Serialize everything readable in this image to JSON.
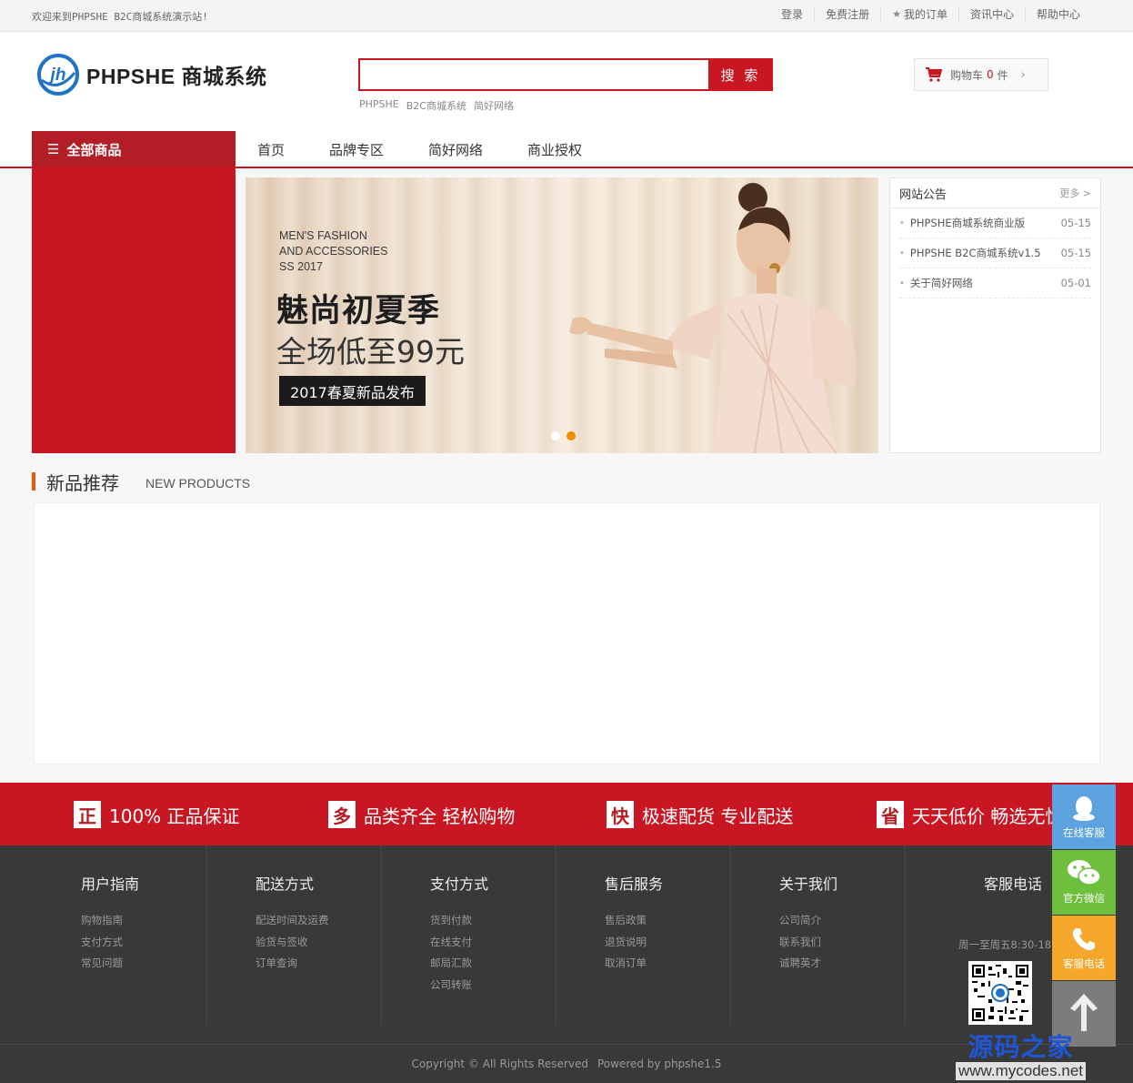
{
  "topbar": {
    "welcome": "欢迎来到PHPSHE B2C商城系统演示站!",
    "links": [
      "登录",
      "免费注册",
      "我的订单",
      "资讯中心",
      "帮助中心"
    ]
  },
  "header": {
    "logo_text": "PHPSHE 商城系统",
    "search_placeholder": "",
    "search_button": "搜 索",
    "hot_words": [
      "PHPSHE",
      "B2C商城系统",
      "简好网络"
    ],
    "cart_label": "购物车",
    "cart_count": "0",
    "cart_unit": "件",
    "cart_arrow": "›"
  },
  "nav": {
    "all_categories": "全部商品",
    "links": [
      "首页",
      "品牌专区",
      "简好网络",
      "商业授权"
    ]
  },
  "banner": {
    "english": "MEN'S FASHION\nAND ACCESSORIES\nSS 2017",
    "headline": "魅尚初夏季",
    "subheadline": "全场低至99元",
    "tag": "2017春夏新品发布",
    "slides": 2,
    "active_slide": 2
  },
  "notice": {
    "title": "网站公告",
    "more": "更多 >",
    "items": [
      {
        "title": "PHPSHE商城系统商业版",
        "date": "05-15"
      },
      {
        "title": "PHPSHE B2C商城系统v1.5",
        "date": "05-15"
      },
      {
        "title": "关于简好网络",
        "date": "05-01"
      }
    ]
  },
  "section": {
    "title": "新品推荐",
    "subtitle": "NEW PRODUCTS"
  },
  "promises": [
    {
      "badge": "正",
      "text": "100% 正品保证"
    },
    {
      "badge": "多",
      "text": "品类齐全 轻松购物"
    },
    {
      "badge": "快",
      "text": "极速配货 专业配送"
    },
    {
      "badge": "省",
      "text": "天天低价 畅选无忧"
    }
  ],
  "footer": {
    "columns": [
      {
        "title": "用户指南",
        "links": [
          "购物指南",
          "支付方式",
          "常见问题"
        ]
      },
      {
        "title": "配送方式",
        "links": [
          "配送时间及运费",
          "验货与签收",
          "订单查询"
        ]
      },
      {
        "title": "支付方式",
        "links": [
          "货到付款",
          "在线支付",
          "邮局汇款",
          "公司转账"
        ]
      },
      {
        "title": "售后服务",
        "links": [
          "售后政策",
          "退货说明",
          "取消订单"
        ]
      },
      {
        "title": "关于我们",
        "links": [
          "公司简介",
          "联系我们",
          "诚聘英才"
        ]
      }
    ],
    "service_title": "客服电话",
    "service_hours": "周一至周五8:30-18",
    "copyright": "Copyright © All Rights Reserved",
    "powered": "Powered by phpshe1.5"
  },
  "side": {
    "online": "在线客服",
    "wechat": "官方微信",
    "phone": "客服电话"
  },
  "watermark": {
    "cn": "源码之家",
    "url": "www.mycodes.net"
  },
  "colors": {
    "brand_red": "#c81623",
    "dark_red": "#b31d25",
    "footer_bg": "#393939",
    "accent_orange": "#e95a0c"
  }
}
